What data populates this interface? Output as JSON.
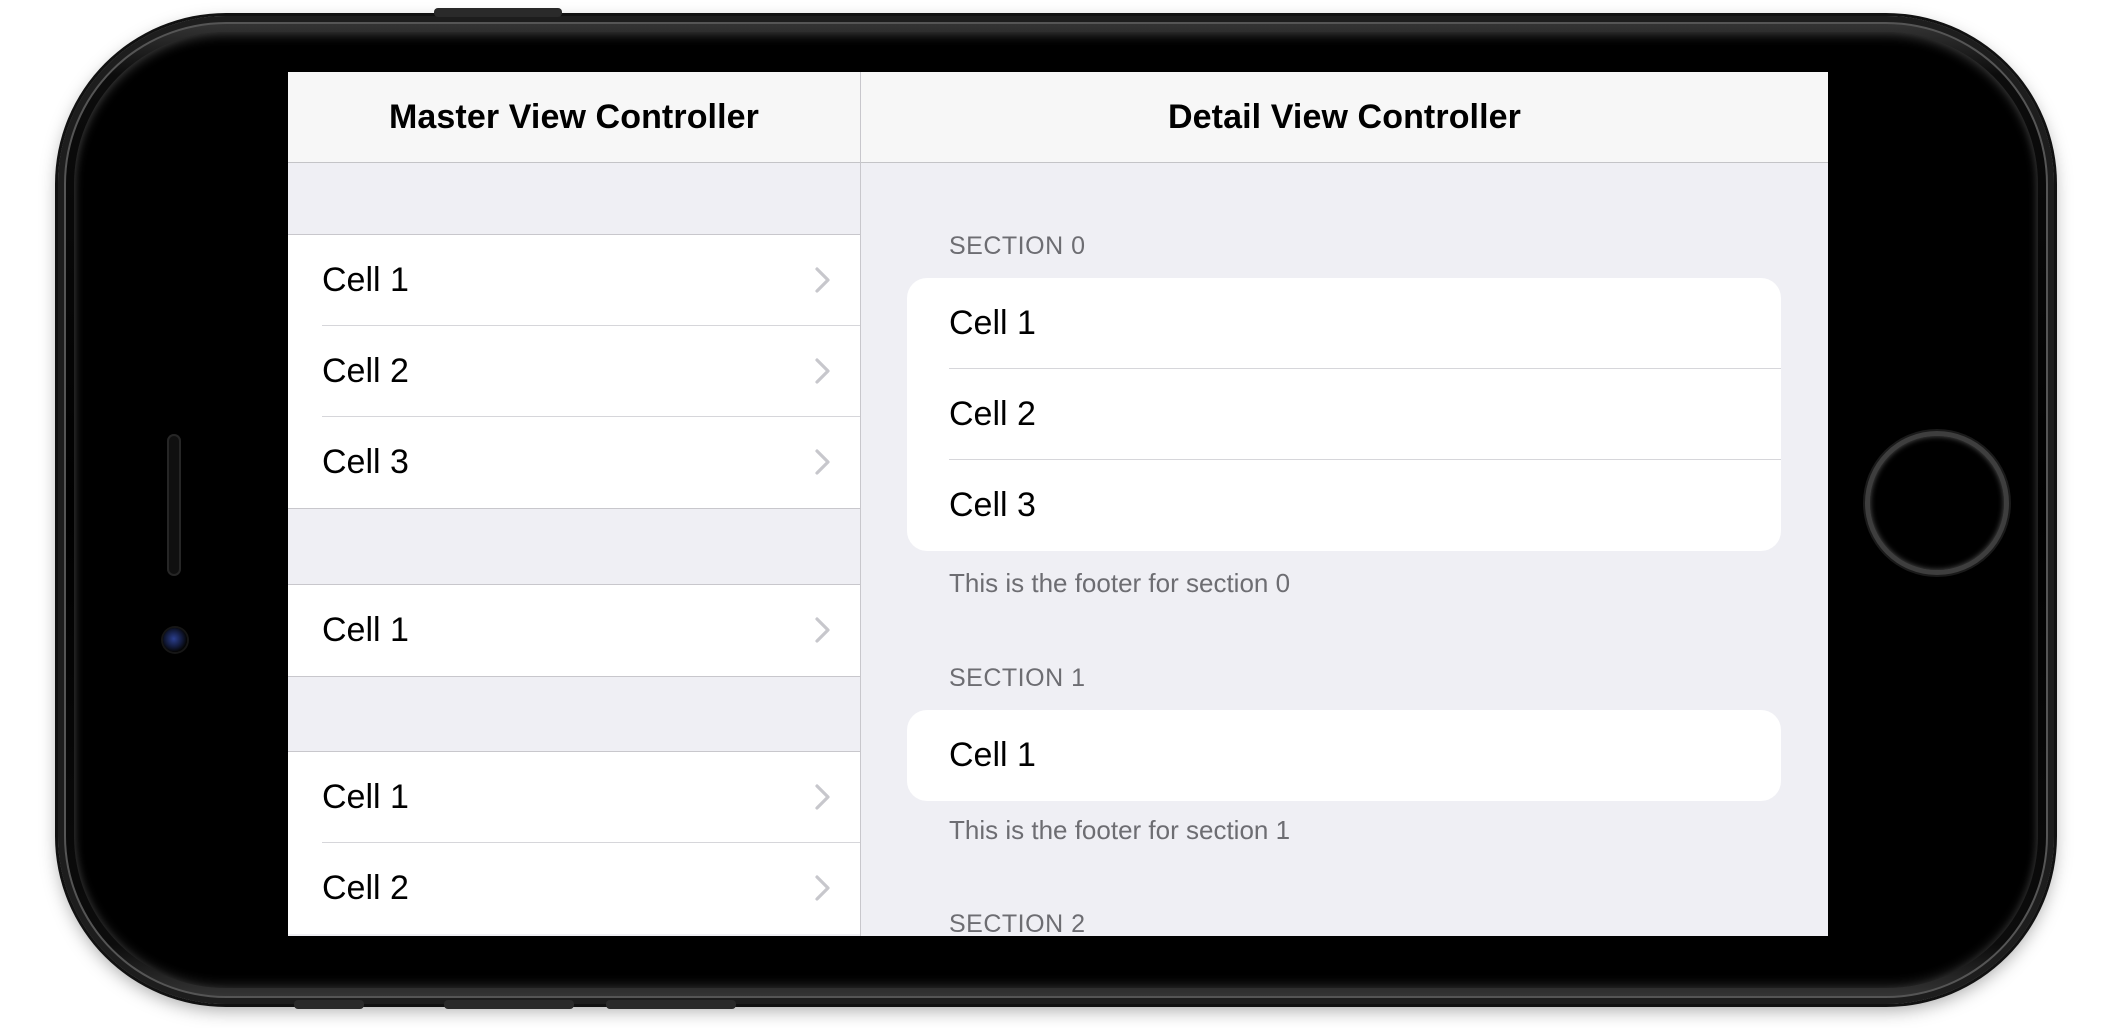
{
  "master": {
    "title": "Master View Controller",
    "sections": [
      {
        "cells": [
          "Cell 1",
          "Cell 2",
          "Cell 3"
        ]
      },
      {
        "cells": [
          "Cell 1"
        ]
      },
      {
        "cells": [
          "Cell 1",
          "Cell 2"
        ]
      }
    ]
  },
  "detail": {
    "title": "Detail View Controller",
    "sections": [
      {
        "header": "SECTION 0",
        "cells": [
          "Cell 1",
          "Cell 2",
          "Cell 3"
        ],
        "footer": "This is the footer for section 0"
      },
      {
        "header": "SECTION 1",
        "cells": [
          "Cell 1"
        ],
        "footer": "This is the footer for section 1"
      },
      {
        "header": "SECTION 2"
      }
    ]
  },
  "icons": {
    "chevron": "chevron-right-icon",
    "home": "home-button"
  },
  "colors": {
    "background": "#efeff4",
    "navbar": "#f7f7f7",
    "chevron": "#c7c7cc",
    "secondary_text": "#6d6d72"
  }
}
